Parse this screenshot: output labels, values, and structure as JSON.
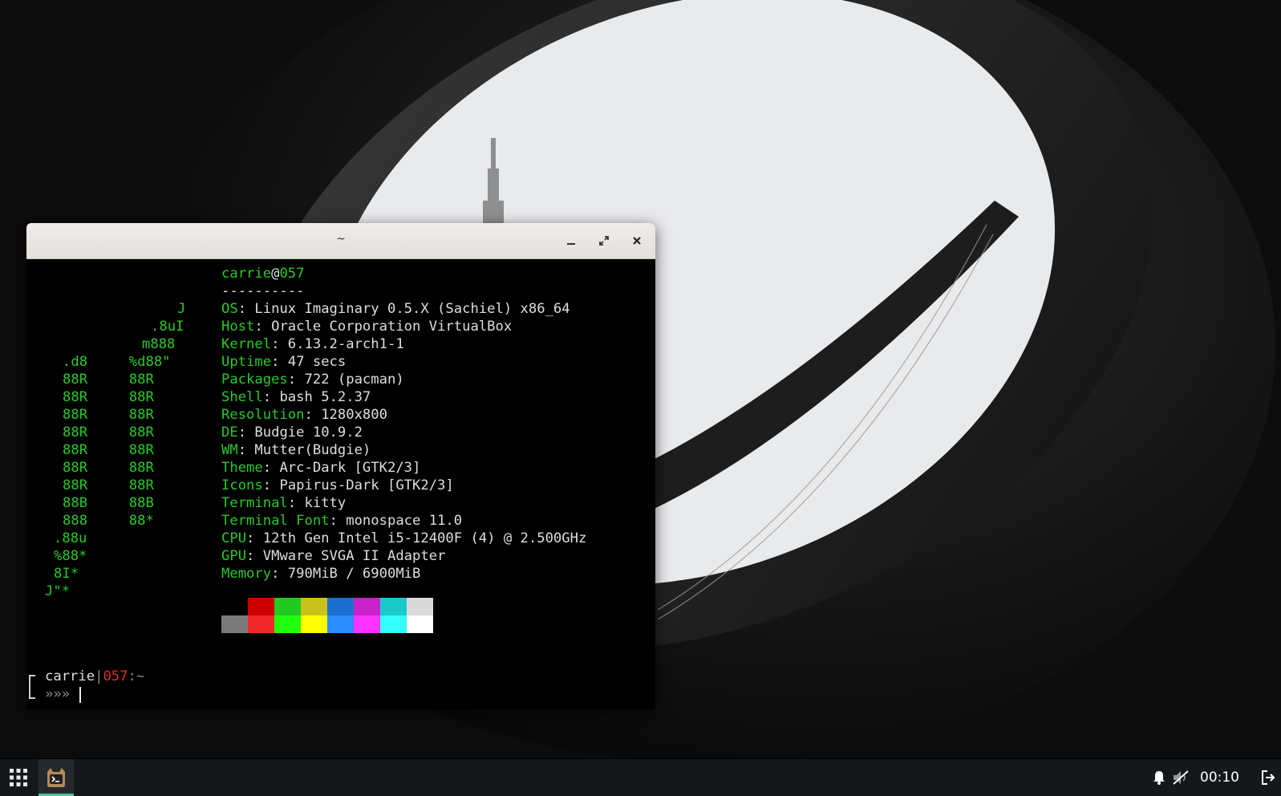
{
  "window": {
    "title": "~"
  },
  "terminal": {
    "user": "carrie",
    "at": "@",
    "host": "057",
    "separator": "----------",
    "logo": [
      "J",
      ".8uI",
      "m888",
      ".d8     %d88\"",
      "88R     88R",
      "88R     88R",
      "88R     88R",
      "88R     88R",
      "88R     88R",
      "88R     88R",
      "88R     88R",
      "88B     88B",
      "888     88*",
      ".88u",
      "%88*",
      "8I*",
      "J\"*"
    ],
    "info": [
      {
        "key": "OS",
        "value": "Linux Imaginary 0.5.X (Sachiel) x86_64"
      },
      {
        "key": "Host",
        "value": "Oracle Corporation VirtualBox"
      },
      {
        "key": "Kernel",
        "value": "6.13.2-arch1-1"
      },
      {
        "key": "Uptime",
        "value": "47 secs"
      },
      {
        "key": "Packages",
        "value": "722 (pacman)"
      },
      {
        "key": "Shell",
        "value": "bash 5.2.37"
      },
      {
        "key": "Resolution",
        "value": "1280x800"
      },
      {
        "key": "DE",
        "value": "Budgie 10.9.2"
      },
      {
        "key": "WM",
        "value": "Mutter(Budgie)"
      },
      {
        "key": "Theme",
        "value": "Arc-Dark [GTK2/3]"
      },
      {
        "key": "Icons",
        "value": "Papirus-Dark [GTK2/3]"
      },
      {
        "key": "Terminal",
        "value": "kitty"
      },
      {
        "key": "Terminal Font",
        "value": "monospace 11.0"
      },
      {
        "key": "CPU",
        "value": "12th Gen Intel i5-12400F (4) @ 2.500GHz"
      },
      {
        "key": "GPU",
        "value": "VMware SVGA II Adapter"
      },
      {
        "key": "Memory",
        "value": "790MiB / 6900MiB"
      }
    ],
    "palette_top": [
      "#000000",
      "#cc0000",
      "#22c922",
      "#c9c21a",
      "#1a6fd1",
      "#c922c9",
      "#1ac9c9",
      "#d9d9d9"
    ],
    "palette_bottom": [
      "#7a7a7a",
      "#ef2929",
      "#22ff11",
      "#ffff00",
      "#2a8cff",
      "#ff33ff",
      "#33ffff",
      "#ffffff"
    ],
    "prompt": {
      "user": "carrie",
      "divider": "|",
      "host": "057",
      "path": ":~",
      "symbol": "»»»"
    }
  },
  "taskbar": {
    "clock": "00:10",
    "icons": [
      "app-grid-icon",
      "kitty-terminal-icon",
      "bell-icon",
      "volume-muted-icon",
      "logout-icon"
    ],
    "active_indicator_color": "#4fc3a1"
  }
}
